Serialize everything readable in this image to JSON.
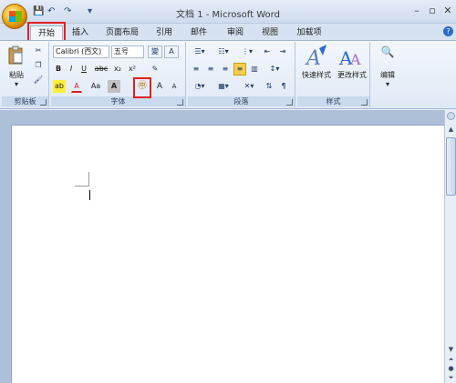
{
  "title_bar": {
    "title": "文档 1 - Microsoft Word",
    "qa_save": "💾",
    "qa_undo": "↶",
    "qa_redo": "↷",
    "qa_customize": "▾"
  },
  "window_controls": {
    "minimize": "–",
    "restore": "▫",
    "close": "✕"
  },
  "tabs": [
    {
      "label": "开始"
    },
    {
      "label": "插入"
    },
    {
      "label": "页面布局"
    },
    {
      "label": "引用"
    },
    {
      "label": "邮件"
    },
    {
      "label": "审阅"
    },
    {
      "label": "视图"
    },
    {
      "label": "加载项"
    }
  ],
  "help_icon": "?",
  "clipboard": {
    "group_label": "剪贴板",
    "paste_label": "粘贴",
    "paste_arrow": "▾"
  },
  "font": {
    "group_label": "字体",
    "font_name": "Calibri (西文)",
    "font_size": "五号",
    "bold": "B",
    "italic": "I",
    "underline": "U",
    "strikethrough": "abc",
    "subscript": "x₂",
    "superscript": "x²",
    "change_case": "Aa",
    "char_shading": "A",
    "phonetic_guide": "㊥",
    "grow_font": "A",
    "shrink_font": "A",
    "highlight": "ab",
    "font_color": "A",
    "clear_format": "✎",
    "char_border": "A"
  },
  "paragraph": {
    "group_label": "段落"
  },
  "styles": {
    "group_label": "样式",
    "quick_styles_label": "快速样式",
    "change_styles_label": "更改样式"
  },
  "editing": {
    "label": "编辑",
    "icon_text": "🔍"
  },
  "colors": {
    "accent": "#2a6bd1",
    "highlight_red": "#e02020",
    "ribbon": "#dfe9f6"
  }
}
